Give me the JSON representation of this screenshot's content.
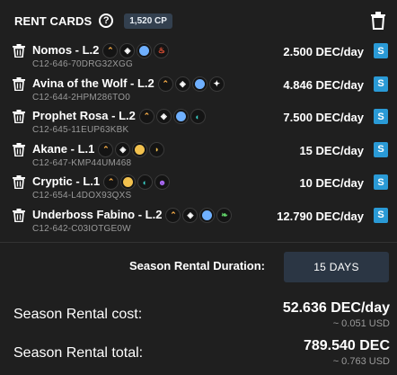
{
  "header": {
    "title": "RENT CARDS",
    "help": "?",
    "cp_badge": "1,520 CP"
  },
  "rows": [
    {
      "name": "Nomos - L.2",
      "id": "C12-646-70DRG32XGG",
      "price": "2.500 DEC/day",
      "badge": "S",
      "icons": [
        {
          "name": "flame-icon",
          "glyph": "⌃",
          "color": "#ffb24a"
        },
        {
          "name": "ability-icon",
          "glyph": "◈",
          "color": "#ffffff"
        },
        {
          "name": "ability-icon",
          "glyph": "",
          "color": "#6fb0ff"
        },
        {
          "name": "ability-icon",
          "glyph": "♨",
          "color": "#ff5a3a"
        }
      ]
    },
    {
      "name": "Avina of the Wolf - L.2",
      "id": "C12-644-2HPM286TO0",
      "price": "4.846 DEC/day",
      "badge": "S",
      "icons": [
        {
          "name": "flame-icon",
          "glyph": "⌃",
          "color": "#ffb24a"
        },
        {
          "name": "ability-icon",
          "glyph": "◈",
          "color": "#ffffff"
        },
        {
          "name": "ability-icon",
          "glyph": "",
          "color": "#6fb0ff"
        },
        {
          "name": "ability-icon",
          "glyph": "✦",
          "color": "#ffffff"
        }
      ]
    },
    {
      "name": "Prophet Rosa - L.2",
      "id": "C12-645-11EUP63KBK",
      "price": "7.500 DEC/day",
      "badge": "S",
      "icons": [
        {
          "name": "flame-icon",
          "glyph": "⌃",
          "color": "#ffb24a"
        },
        {
          "name": "ability-icon",
          "glyph": "◈",
          "color": "#ffffff"
        },
        {
          "name": "ability-icon",
          "glyph": "",
          "color": "#6fb0ff"
        },
        {
          "name": "ability-icon",
          "glyph": "◐",
          "color": "#3ad0c8"
        }
      ]
    },
    {
      "name": "Akane - L.1",
      "id": "C12-647-KMP44UM468",
      "price": "15 DEC/day",
      "badge": "S",
      "icons": [
        {
          "name": "flame-icon",
          "glyph": "⌃",
          "color": "#ffb24a"
        },
        {
          "name": "ability-icon",
          "glyph": "◈",
          "color": "#ffffff"
        },
        {
          "name": "ability-icon",
          "glyph": "",
          "color": "#f2c14e"
        },
        {
          "name": "ability-icon",
          "glyph": "◗",
          "color": "#f2c14e"
        }
      ]
    },
    {
      "name": "Cryptic - L.1",
      "id": "C12-654-L4DOX93QXS",
      "price": "10 DEC/day",
      "badge": "S",
      "icons": [
        {
          "name": "flame-icon",
          "glyph": "⌃",
          "color": "#ffb24a"
        },
        {
          "name": "ability-icon",
          "glyph": "",
          "color": "#f2c14e"
        },
        {
          "name": "ability-icon",
          "glyph": "◐",
          "color": "#3ad0c8"
        },
        {
          "name": "ability-icon",
          "glyph": "☻",
          "color": "#b06cff"
        }
      ]
    },
    {
      "name": "Underboss Fabino - L.2",
      "id": "C12-642-C03IOTGE0W",
      "price": "12.790 DEC/day",
      "badge": "S",
      "icons": [
        {
          "name": "flame-icon",
          "glyph": "⌃",
          "color": "#ffb24a"
        },
        {
          "name": "ability-icon",
          "glyph": "◈",
          "color": "#ffffff"
        },
        {
          "name": "ability-icon",
          "glyph": "",
          "color": "#6fb0ff"
        },
        {
          "name": "ability-icon",
          "glyph": "❧",
          "color": "#62d66a"
        }
      ]
    }
  ],
  "duration": {
    "label": "Season Rental Duration:",
    "value": "15 DAYS"
  },
  "cost": {
    "label": "Season Rental cost:",
    "value": "52.636 DEC/day",
    "usd": "~ 0.051 USD"
  },
  "total": {
    "label": "Season Rental total:",
    "value": "789.540 DEC",
    "usd": "~ 0.763 USD"
  }
}
